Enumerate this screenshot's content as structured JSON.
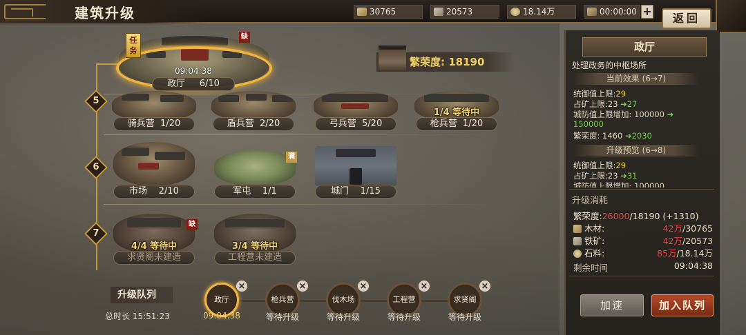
{
  "header": {
    "title": "建筑升级",
    "resources": [
      {
        "icon": "wood-icon",
        "value": "30765"
      },
      {
        "icon": "iron-icon",
        "value": "20573"
      },
      {
        "icon": "stone-icon",
        "value": "18.14万"
      },
      {
        "icon": "time-icon",
        "value": "00:00:00"
      }
    ],
    "plus": "+",
    "back": "返回"
  },
  "prosperity": {
    "label": "繁荣度: 18190"
  },
  "tree": {
    "levels": [
      "5",
      "6",
      "7"
    ],
    "selected": {
      "name": "政厅     6/10",
      "timer": "09:04:38",
      "task_badge": "任务",
      "missing_badge": "缺"
    },
    "row5": [
      {
        "name": "骑兵营  1/20"
      },
      {
        "name": "盾兵营  2/20"
      },
      {
        "name": "弓兵营  5/20"
      },
      {
        "name": "枪兵营  1/20",
        "status": "1/4  等待中"
      }
    ],
    "row6": [
      {
        "name": "市场    2/10"
      },
      {
        "name": "军屯    1/1",
        "badge": "满"
      },
      {
        "name": "城门    1/15"
      }
    ],
    "row7": [
      {
        "name": "求贤阁未建造",
        "status": "4/4  等待中",
        "badge": "缺"
      },
      {
        "name": "工程营未建造",
        "status": "3/4  等待中"
      }
    ]
  },
  "panel": {
    "title": "政厅",
    "description": "处理政务的中枢场所",
    "current_effect_title": "当前效果 (6→7)",
    "current_effects": [
      {
        "label": "统御值上限:",
        "from": "29",
        "to": ""
      },
      {
        "label": "占矿上限:23 ",
        "from": "",
        "to": "27"
      },
      {
        "label": "城防值上限增加: 100000 ",
        "from": "",
        "to": ""
      },
      {
        "label": "",
        "from": "",
        "to": "150000"
      },
      {
        "label": "繁荣度: 1460 ",
        "from": "",
        "to": "2030"
      }
    ],
    "preview_title": "升级预览 (6→8)",
    "preview_effects": [
      {
        "label": "统御值上限:",
        "from": "29"
      },
      {
        "label": "占矿上限:23 ",
        "to": "31"
      },
      {
        "label": "城防值上限增加: 100000"
      }
    ],
    "cost_title": "升级消耗",
    "costs": {
      "prosperity_label": "繁荣度:",
      "prosperity_need": "26000",
      "prosperity_have": "/18190 (+1310)",
      "wood_label": "木材:",
      "wood_need": "42万",
      "wood_have": "/30765",
      "iron_label": "铁矿:",
      "iron_need": "42万",
      "iron_have": "/20573",
      "stone_label": "石料:",
      "stone_need": "85万",
      "stone_have": "/18.14万",
      "time_label": "剩余时间",
      "time_value": "09:04:38"
    },
    "speedup_button": "加速",
    "queue_button": "加入队列"
  },
  "queue": {
    "label": "升级队列",
    "total": "总时长  15:51:23",
    "items": [
      {
        "name": "政厅",
        "sub": "09:04:38"
      },
      {
        "name": "枪兵营",
        "sub": "等待升级"
      },
      {
        "name": "伐木场",
        "sub": "等待升级"
      },
      {
        "name": "工程营",
        "sub": "等待升级"
      },
      {
        "name": "求贤阁",
        "sub": "等待升级"
      }
    ],
    "close": "×"
  }
}
